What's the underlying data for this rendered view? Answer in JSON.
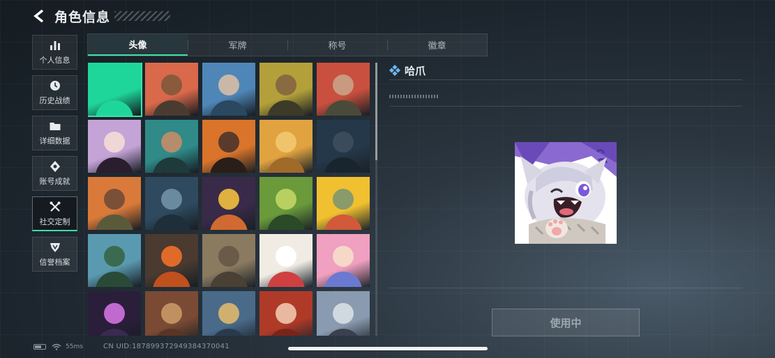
{
  "header": {
    "title": "角色信息",
    "back_icon": "chevron-left-icon"
  },
  "sidebar": {
    "items": [
      {
        "label": "个人信息",
        "icon": "bar-chart-icon",
        "active": false
      },
      {
        "label": "历史战绩",
        "icon": "clock-icon",
        "active": false
      },
      {
        "label": "详细数据",
        "icon": "folder-icon",
        "active": false
      },
      {
        "label": "账号成就",
        "icon": "achievement-icon",
        "active": false
      },
      {
        "label": "社交定制",
        "icon": "tools-icon",
        "active": true
      },
      {
        "label": "信誉档案",
        "icon": "shield-icon",
        "active": false
      }
    ]
  },
  "tabs": [
    {
      "label": "头像",
      "active": true
    },
    {
      "label": "军牌",
      "active": false
    },
    {
      "label": "称号",
      "active": false
    },
    {
      "label": "徽章",
      "active": false
    }
  ],
  "detail": {
    "name": "哈爪",
    "name_icon": "diamond-icon",
    "use_button": "使用中"
  },
  "status": {
    "ping": "55ms",
    "uid": "CN UID:187899372949384370041"
  },
  "colors": {
    "accent": "#3fe0a6"
  },
  "avatars": [
    {
      "name": "avatar-green-blank",
      "bg": "#1fd69a",
      "skin": "#1fd69a",
      "cloth": "#1fd69a"
    },
    {
      "name": "avatar-bearded-soldier-cap",
      "bg": "#d9694a",
      "skin": "#8a5a3c",
      "cloth": "#4a3b30"
    },
    {
      "name": "avatar-pilot-headset",
      "bg": "#4f86b8",
      "skin": "#c9b8a8",
      "cloth": "#2a4860"
    },
    {
      "name": "avatar-bald-bearded-soldier",
      "bg": "#b3a03a",
      "skin": "#8a6a40",
      "cloth": "#3d3a28"
    },
    {
      "name": "avatar-helmet-soldier-red",
      "bg": "#c9503e",
      "skin": "#c99a80",
      "cloth": "#4a4a3a"
    },
    {
      "name": "avatar-white-hair-girl",
      "bg": "#c4a3d6",
      "skin": "#f0d6d6",
      "cloth": "#2a1e2e"
    },
    {
      "name": "avatar-bearded-man-teal",
      "bg": "#2f8a88",
      "skin": "#b58c6c",
      "cloth": "#1f3a3a"
    },
    {
      "name": "avatar-masked-man-orange",
      "bg": "#d9742a",
      "skin": "#5a3a2a",
      "cloth": "#2a1e18"
    },
    {
      "name": "avatar-triangle-gold",
      "bg": "#e0a340",
      "skin": "#f0c46a",
      "cloth": "#a06a28"
    },
    {
      "name": "avatar-soldier-night",
      "bg": "#24384a",
      "skin": "#3a4c5c",
      "cloth": "#18242e"
    },
    {
      "name": "avatar-soldier-explosion",
      "bg": "#d97a3a",
      "skin": "#7a5038",
      "cloth": "#5a5a3a"
    },
    {
      "name": "avatar-sniper-scope",
      "bg": "#2f4a5e",
      "skin": "#6a8aa0",
      "cloth": "#1e2e3a"
    },
    {
      "name": "avatar-map-book",
      "bg": "#3a2a4a",
      "skin": "#e0b040",
      "cloth": "#d06a30"
    },
    {
      "name": "avatar-exit-sign",
      "bg": "#6a9a3a",
      "skin": "#b8d060",
      "cloth": "#2a4a28"
    },
    {
      "name": "avatar-food-plate-hands",
      "bg": "#f0c030",
      "skin": "#8a9a6a",
      "cloth": "#d05a3a"
    },
    {
      "name": "avatar-way-out-sign",
      "bg": "#5a9ab0",
      "skin": "#3a6a50",
      "cloth": "#2a4a38"
    },
    {
      "name": "avatar-orange-feather",
      "bg": "#4a3a30",
      "skin": "#e06a2a",
      "cloth": "#c0501e"
    },
    {
      "name": "avatar-abandoned-truck",
      "bg": "#8a7a60",
      "skin": "#6a5a48",
      "cloth": "#4a4034"
    },
    {
      "name": "avatar-snowman",
      "bg": "#f0ece4",
      "skin": "#ffffff",
      "cloth": "#d04040"
    },
    {
      "name": "avatar-anime-girl-goggles",
      "bg": "#f0a0c0",
      "skin": "#f6d8c8",
      "cloth": "#6a7ad0"
    },
    {
      "name": "avatar-fireworks",
      "bg": "#2a1e3a",
      "skin": "#c06ad0",
      "cloth": "#3a2a50"
    },
    {
      "name": "avatar-scales-emblem",
      "bg": "#7a4a34",
      "skin": "#c09060",
      "cloth": "#5a3424"
    },
    {
      "name": "avatar-dragon",
      "bg": "#4a6a8a",
      "skin": "#d0b070",
      "cloth": "#2a3a4e"
    },
    {
      "name": "avatar-red-hair-woman",
      "bg": "#b03a28",
      "skin": "#e8b8a0",
      "cloth": "#7a2418"
    },
    {
      "name": "avatar-mountain-soldier",
      "bg": "#8a9ab0",
      "skin": "#d0d8e0",
      "cloth": "#3a4050"
    }
  ]
}
